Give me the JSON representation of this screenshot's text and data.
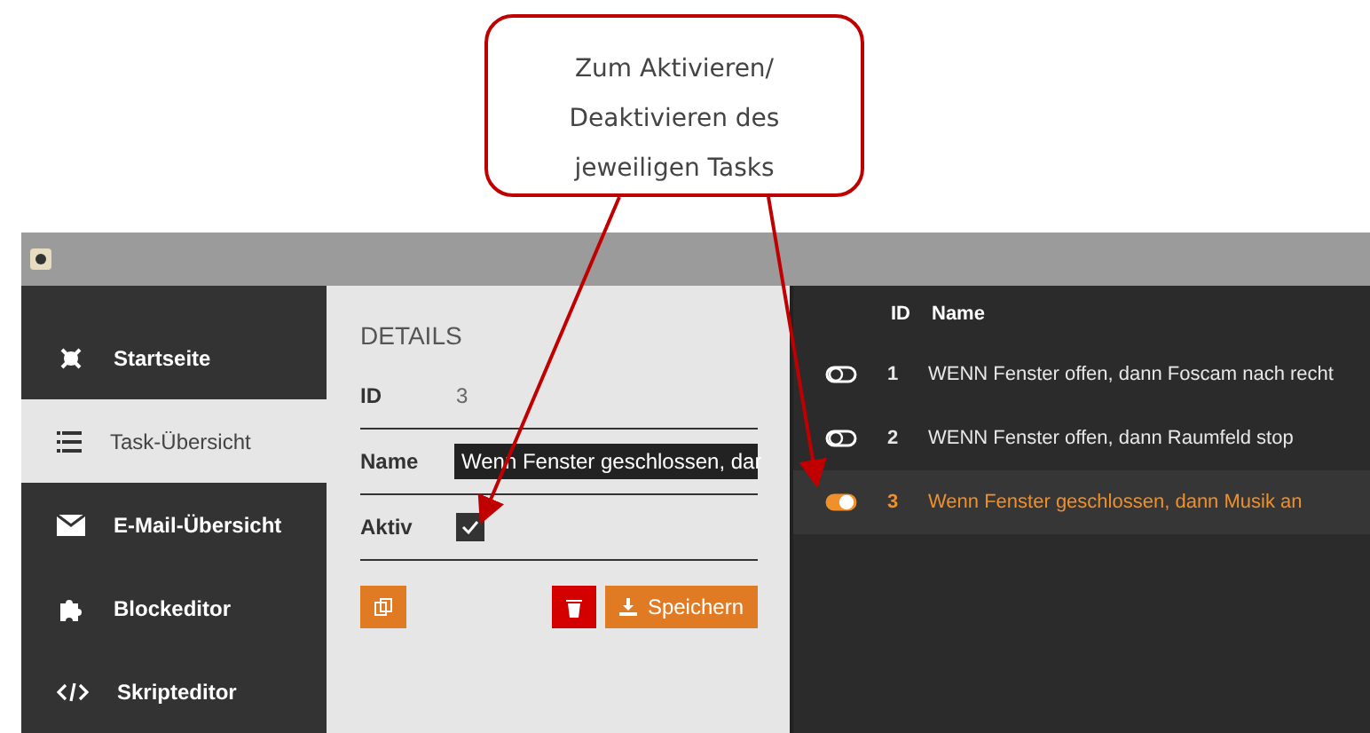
{
  "callout": {
    "lines": [
      "Zum Aktivieren/",
      "Deaktivieren des",
      "jeweiligen Tasks"
    ]
  },
  "sidebar": {
    "items": [
      {
        "label": "Startseite",
        "selected": false
      },
      {
        "label": "Task-Übersicht",
        "selected": true
      },
      {
        "label": "E-Mail-Übersicht",
        "selected": false
      },
      {
        "label": "Blockeditor",
        "selected": false
      },
      {
        "label": "Skripteditor",
        "selected": false
      }
    ]
  },
  "details": {
    "heading": "DETAILS",
    "id_label": "ID",
    "id_value": "3",
    "name_label": "Name",
    "name_value": "Wenn Fenster geschlossen, dar",
    "active_label": "Aktiv",
    "active_checked": true,
    "save_label": "Speichern"
  },
  "tasks": {
    "columns": [
      "ID",
      "Name"
    ],
    "rows": [
      {
        "id": "1",
        "name": "WENN Fenster offen, dann Foscam nach recht",
        "on": false,
        "selected": false
      },
      {
        "id": "2",
        "name": "WENN Fenster offen, dann Raumfeld stop",
        "on": false,
        "selected": false
      },
      {
        "id": "3",
        "name": "Wenn Fenster geschlossen, dann Musik an",
        "on": true,
        "selected": true
      }
    ]
  }
}
